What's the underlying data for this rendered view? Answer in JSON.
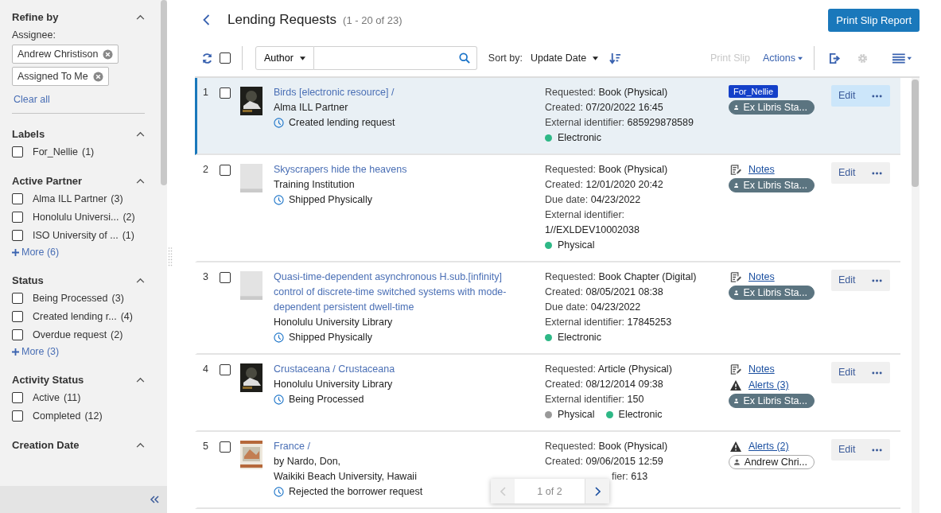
{
  "sidebar": {
    "title": "Refine by",
    "assignee_label": "Assignee:",
    "assignee_chips": [
      "Andrew Christison",
      "Assigned To Me"
    ],
    "clear_all": "Clear all",
    "sections": [
      {
        "title": "Labels",
        "expanded": true,
        "options": [
          {
            "label": "For_Nellie",
            "count": "(1)",
            "checked": false
          }
        ]
      },
      {
        "title": "Active Partner",
        "expanded": true,
        "options": [
          {
            "label": "Alma ILL Partner",
            "count": "(3)",
            "checked": false
          },
          {
            "label": "Honolulu Universi...",
            "count": "(2)",
            "checked": false
          },
          {
            "label": "ISO University of ...",
            "count": "(1)",
            "checked": false
          }
        ],
        "more": "More (6)"
      },
      {
        "title": "Status",
        "expanded": true,
        "options": [
          {
            "label": "Being Processed",
            "count": "(3)",
            "checked": false
          },
          {
            "label": "Created lending r...",
            "count": "(4)",
            "checked": false
          },
          {
            "label": "Overdue request",
            "count": "(2)",
            "checked": false
          }
        ],
        "more": "More (3)"
      },
      {
        "title": "Activity Status",
        "expanded": true,
        "options": [
          {
            "label": "Active",
            "count": "(11)",
            "checked": false
          },
          {
            "label": "Completed",
            "count": "(12)",
            "checked": false
          }
        ]
      },
      {
        "title": "Creation Date",
        "expanded": true
      }
    ]
  },
  "header": {
    "title": "Lending Requests",
    "count": "(1 - 20 of 23)",
    "print_report": "Print Slip Report"
  },
  "toolbar": {
    "select_all": false,
    "search_by": "Author",
    "sort_label": "Sort by:",
    "sort_value": "Update Date",
    "print_slip": {
      "label": "Print Slip",
      "disabled": true
    },
    "actions": "Actions",
    "settings_disabled": true
  },
  "rows": [
    {
      "number": "1",
      "checked": false,
      "selected": true,
      "thumbnail": {
        "kind": "picture"
      },
      "title": "Birds [electronic resource] /",
      "lines": [
        "Alma ILL Partner"
      ],
      "status": "Created lending request",
      "details": [
        {
          "label": "Requested:",
          "value": "Book (Physical)"
        },
        {
          "label": "Created:",
          "value": "07/20/2022 16:45"
        },
        {
          "label": "External identifier:",
          "value": "685929878589"
        }
      ],
      "formats": [
        {
          "label": "Electronic",
          "color": "#2eb886"
        }
      ],
      "tags": [
        {
          "kind": "label",
          "text": "For_Nellie"
        },
        {
          "kind": "assignee",
          "text": "Ex Libris Sta...",
          "filled": true
        }
      ],
      "edit": "Edit"
    },
    {
      "number": "2",
      "checked": false,
      "selected": false,
      "thumbnail": {
        "kind": "placeholder"
      },
      "title": "Skyscrapers hide the heavens",
      "lines": [
        "Training Institution"
      ],
      "status": "Shipped Physically",
      "details": [
        {
          "label": "Requested:",
          "value": "Book (Physical)"
        },
        {
          "label": "Created:",
          "value": "12/01/2020 20:42"
        },
        {
          "label": "Due date:",
          "value": "04/23/2022"
        },
        {
          "label": "External identifier:",
          "value": "1//EXLDEV10002038"
        }
      ],
      "formats": [
        {
          "label": "Physical",
          "color": "#2eb886"
        }
      ],
      "tags": [
        {
          "kind": "notes",
          "text": "Notes"
        },
        {
          "kind": "assignee",
          "text": "Ex Libris Sta...",
          "filled": true
        }
      ],
      "edit": "Edit"
    },
    {
      "number": "3",
      "checked": false,
      "selected": false,
      "thumbnail": {
        "kind": "placeholder"
      },
      "title": "Quasi-time-dependent asynchronous H.sub.[infinity] control of discrete-time switched systems with mode-dependent persistent dwell-time",
      "lines": [
        "Honolulu University Library"
      ],
      "status": "Shipped Physically",
      "details": [
        {
          "label": "Requested:",
          "value": "Book Chapter (Digital)"
        },
        {
          "label": "Created:",
          "value": "08/05/2021 08:38"
        },
        {
          "label": "Due date:",
          "value": "04/23/2022"
        },
        {
          "label": "External identifier:",
          "value": "17845253"
        }
      ],
      "formats": [
        {
          "label": "Electronic",
          "color": "#2eb886"
        }
      ],
      "tags": [
        {
          "kind": "notes",
          "text": "Notes"
        },
        {
          "kind": "assignee",
          "text": "Ex Libris Sta...",
          "filled": true
        }
      ],
      "edit": "Edit"
    },
    {
      "number": "4",
      "checked": false,
      "selected": false,
      "thumbnail": {
        "kind": "picture"
      },
      "title": "Crustaceana / Crustaceana",
      "lines": [
        "Honolulu University Library"
      ],
      "status": "Being Processed",
      "details": [
        {
          "label": "Requested:",
          "value": "Article (Physical)"
        },
        {
          "label": "Created:",
          "value": "08/12/2014 09:38"
        },
        {
          "label": "External identifier:",
          "value": "150"
        }
      ],
      "formats": [
        {
          "label": "Physical",
          "color": "#999999"
        },
        {
          "label": "Electronic",
          "color": "#2eb886"
        }
      ],
      "tags": [
        {
          "kind": "notes",
          "text": "Notes"
        },
        {
          "kind": "alerts",
          "text": "Alerts (3)"
        },
        {
          "kind": "assignee",
          "text": "Ex Libris Sta...",
          "filled": true
        }
      ],
      "edit": "Edit"
    },
    {
      "number": "5",
      "checked": false,
      "selected": false,
      "thumbnail": {
        "kind": "picture"
      },
      "title": "France /",
      "lines": [
        "by Nardo, Don,",
        "Waikiki Beach University, Hawaii"
      ],
      "status": "Rejected the borrower request",
      "details": [
        {
          "label": "Requested:",
          "value": "Book (Physical)"
        },
        {
          "label": "Created:",
          "value": "09/06/2015 12:59"
        },
        {
          "label": "fier:",
          "value": "613",
          "covered": true
        }
      ],
      "formats": [],
      "tags": [
        {
          "kind": "alerts",
          "text": "Alerts (2)"
        },
        {
          "kind": "assignee",
          "text": "Andrew Chri...",
          "filled": false
        }
      ],
      "edit": "Edit"
    }
  ],
  "pager": {
    "text": "1 of 2",
    "prev_disabled": true,
    "next_disabled": false
  }
}
